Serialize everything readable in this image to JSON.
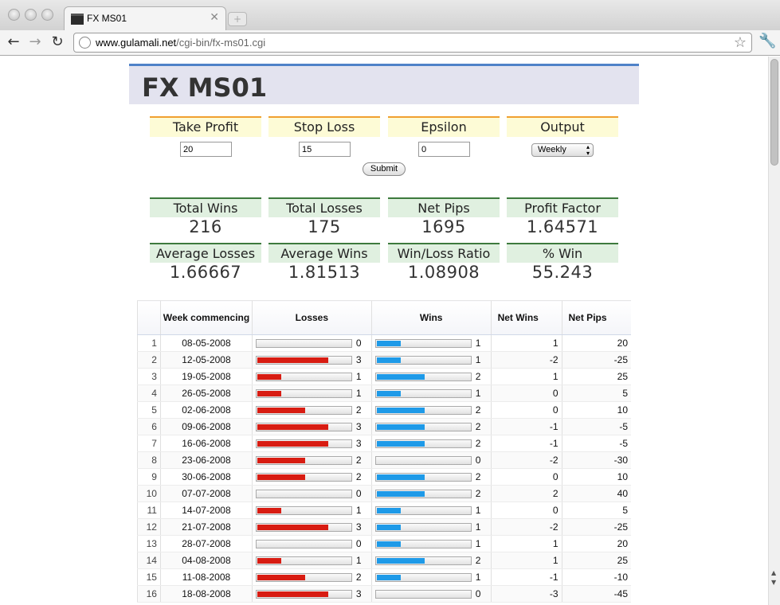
{
  "browser": {
    "tab_title": "FX MS01",
    "url_host": "www.gulamali.net",
    "url_path": "/cgi-bin/fx-ms01.cgi"
  },
  "page": {
    "title": "FX MS01"
  },
  "params": {
    "take_profit": {
      "label": "Take Profit",
      "value": "20"
    },
    "stop_loss": {
      "label": "Stop Loss",
      "value": "15"
    },
    "epsilon": {
      "label": "Epsilon",
      "value": "0"
    },
    "output": {
      "label": "Output",
      "value": "Weekly"
    },
    "submit_label": "Submit"
  },
  "stats": {
    "total_wins": {
      "label": "Total Wins",
      "value": "216"
    },
    "total_losses": {
      "label": "Total Losses",
      "value": "175"
    },
    "net_pips": {
      "label": "Net Pips",
      "value": "1695"
    },
    "profit_factor": {
      "label": "Profit Factor",
      "value": "1.64571"
    },
    "average_losses": {
      "label": "Average Losses",
      "value": "1.66667"
    },
    "average_wins": {
      "label": "Average Wins",
      "value": "1.81513"
    },
    "win_loss_ratio": {
      "label": "Win/Loss Ratio",
      "value": "1.08908"
    },
    "pct_win": {
      "label": "% Win",
      "value": "55.243"
    }
  },
  "table": {
    "headers": {
      "week": "Week commencing",
      "losses": "Losses",
      "wins": "Wins",
      "net_wins": "Net Wins",
      "net_pips": "Net Pips"
    },
    "bar_max": 4,
    "colors": {
      "loss": "#d81c12",
      "win": "#1e9ae8"
    },
    "rows": [
      {
        "idx": "1",
        "week": "08-05-2008",
        "losses": 0,
        "wins": 1,
        "net_wins": "1",
        "net_pips": "20"
      },
      {
        "idx": "2",
        "week": "12-05-2008",
        "losses": 3,
        "wins": 1,
        "net_wins": "-2",
        "net_pips": "-25"
      },
      {
        "idx": "3",
        "week": "19-05-2008",
        "losses": 1,
        "wins": 2,
        "net_wins": "1",
        "net_pips": "25"
      },
      {
        "idx": "4",
        "week": "26-05-2008",
        "losses": 1,
        "wins": 1,
        "net_wins": "0",
        "net_pips": "5"
      },
      {
        "idx": "5",
        "week": "02-06-2008",
        "losses": 2,
        "wins": 2,
        "net_wins": "0",
        "net_pips": "10"
      },
      {
        "idx": "6",
        "week": "09-06-2008",
        "losses": 3,
        "wins": 2,
        "net_wins": "-1",
        "net_pips": "-5"
      },
      {
        "idx": "7",
        "week": "16-06-2008",
        "losses": 3,
        "wins": 2,
        "net_wins": "-1",
        "net_pips": "-5"
      },
      {
        "idx": "8",
        "week": "23-06-2008",
        "losses": 2,
        "wins": 0,
        "net_wins": "-2",
        "net_pips": "-30"
      },
      {
        "idx": "9",
        "week": "30-06-2008",
        "losses": 2,
        "wins": 2,
        "net_wins": "0",
        "net_pips": "10"
      },
      {
        "idx": "10",
        "week": "07-07-2008",
        "losses": 0,
        "wins": 2,
        "net_wins": "2",
        "net_pips": "40"
      },
      {
        "idx": "11",
        "week": "14-07-2008",
        "losses": 1,
        "wins": 1,
        "net_wins": "0",
        "net_pips": "5"
      },
      {
        "idx": "12",
        "week": "21-07-2008",
        "losses": 3,
        "wins": 1,
        "net_wins": "-2",
        "net_pips": "-25"
      },
      {
        "idx": "13",
        "week": "28-07-2008",
        "losses": 0,
        "wins": 1,
        "net_wins": "1",
        "net_pips": "20"
      },
      {
        "idx": "14",
        "week": "04-08-2008",
        "losses": 1,
        "wins": 2,
        "net_wins": "1",
        "net_pips": "25"
      },
      {
        "idx": "15",
        "week": "11-08-2008",
        "losses": 2,
        "wins": 1,
        "net_wins": "-1",
        "net_pips": "-10"
      },
      {
        "idx": "16",
        "week": "18-08-2008",
        "losses": 3,
        "wins": 0,
        "net_wins": "-3",
        "net_pips": "-45"
      }
    ]
  }
}
